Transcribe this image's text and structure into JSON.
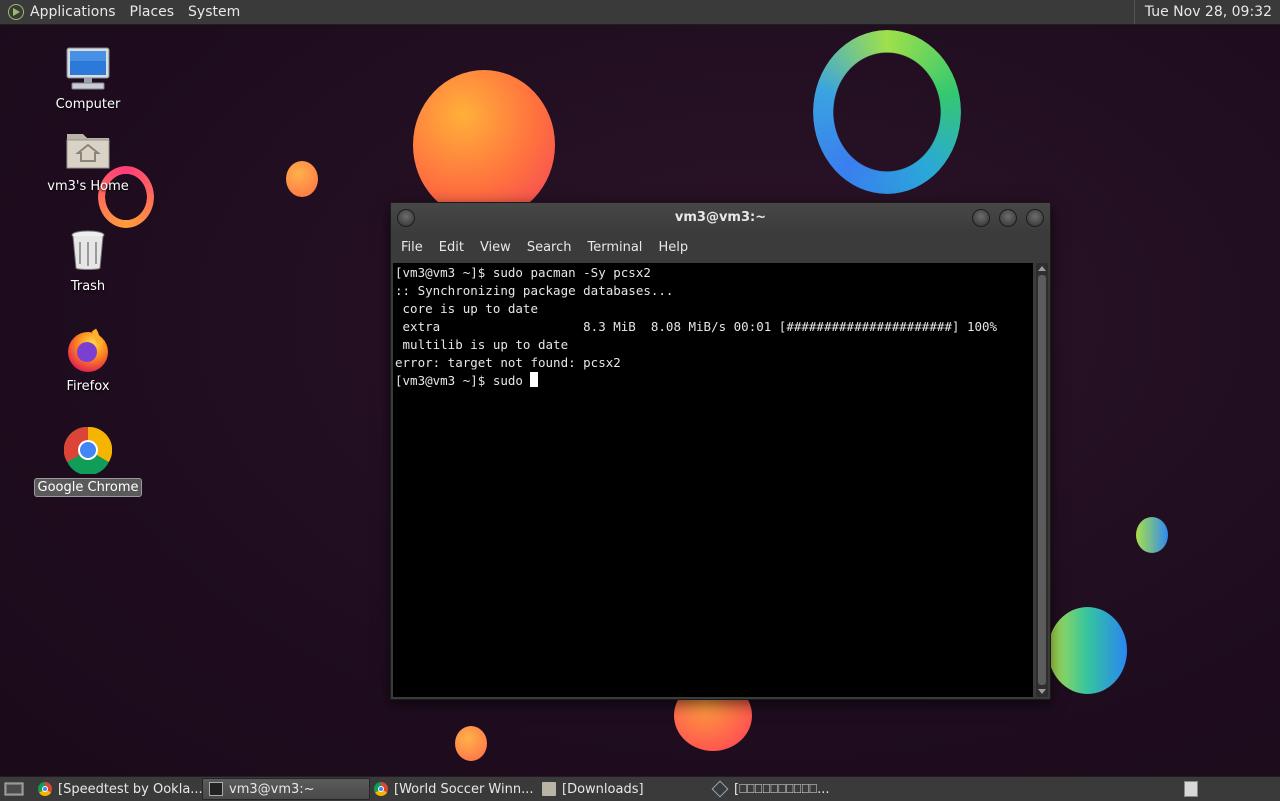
{
  "top_panel": {
    "menus": [
      "Applications",
      "Places",
      "System"
    ],
    "clock": "Tue Nov 28, 09:32"
  },
  "desktop_icons": [
    {
      "label": "Computer",
      "icon": "computer-icon"
    },
    {
      "label": "vm3's Home",
      "icon": "home-folder-icon"
    },
    {
      "label": "Trash",
      "icon": "trash-icon"
    },
    {
      "label": "Firefox",
      "icon": "firefox-icon"
    },
    {
      "label": "Google Chrome",
      "icon": "chrome-icon",
      "selected": true
    }
  ],
  "terminal": {
    "title": "vm3@vm3:~",
    "menu": [
      "File",
      "Edit",
      "View",
      "Search",
      "Terminal",
      "Help"
    ],
    "lines": [
      "[vm3@vm3 ~]$ sudo pacman -Sy pcsx2",
      ":: Synchronizing package databases...",
      " core is up to date",
      " extra                   8.3 MiB  8.08 MiB/s 00:01 [######################] 100%",
      " multilib is up to date",
      "error: target not found: pcsx2"
    ],
    "prompt_line": "[vm3@vm3 ~]$ sudo "
  },
  "taskbar": {
    "tasks": [
      {
        "label": "[Speedtest by Ookla...",
        "icon": "chrome-icon",
        "active": false
      },
      {
        "label": "vm3@vm3:~",
        "icon": "terminal-icon",
        "active": true
      },
      {
        "label": "[World Soccer Winn...",
        "icon": "chrome-icon",
        "active": false
      },
      {
        "label": "[Downloads]",
        "icon": "folder-icon",
        "active": false
      }
    ],
    "tray_text": "[⎕⎕⎕⎕⎕⎕⎕⎕⎕⎕..."
  }
}
